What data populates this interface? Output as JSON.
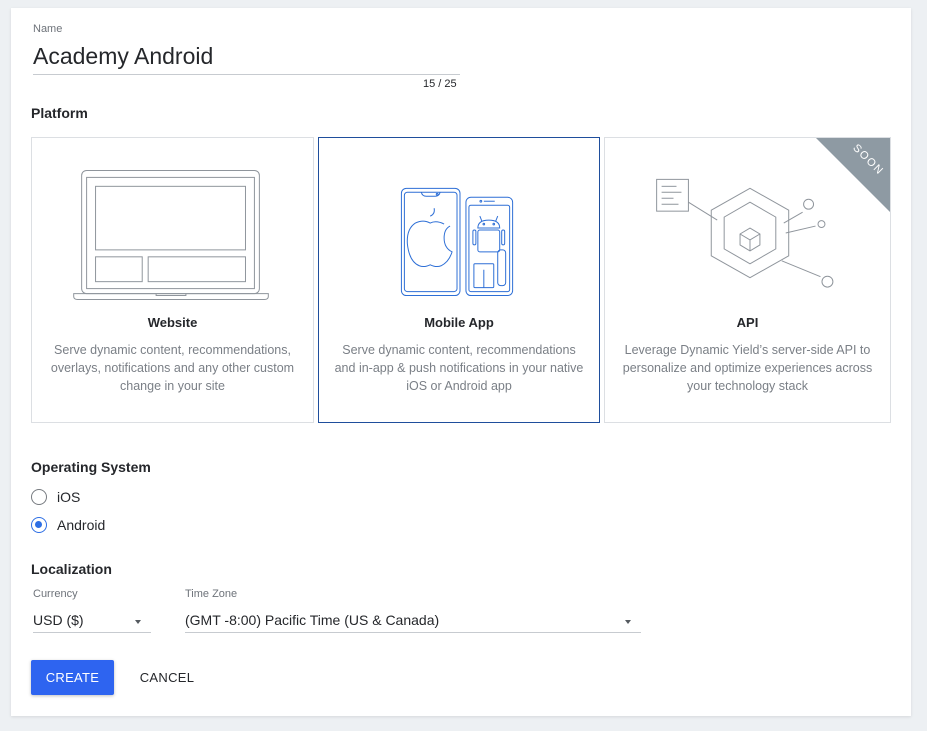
{
  "name_field": {
    "label": "Name",
    "value": "Academy Android",
    "char_count": "15 / 25"
  },
  "platform": {
    "title": "Platform",
    "cards": [
      {
        "title": "Website",
        "description": "Serve dynamic content, recommendations, overlays, notifications and any other custom change in your site",
        "illustration": "laptop-icon",
        "selected": false
      },
      {
        "title": "Mobile App",
        "description": "Serve dynamic content, recommendations and in-app & push notifications in your native iOS or Android app",
        "illustration": "mobile-phones-icon",
        "selected": true
      },
      {
        "title": "API",
        "description": "Leverage Dynamic Yield’s server-side API to personalize and optimize experiences across your technology stack",
        "illustration": "api-hexagon-icon",
        "selected": false,
        "badge": "SOON"
      }
    ]
  },
  "operating_system": {
    "title": "Operating System",
    "options": [
      {
        "label": "iOS",
        "checked": false
      },
      {
        "label": "Android",
        "checked": true
      }
    ]
  },
  "localization": {
    "title": "Localization",
    "currency": {
      "label": "Currency",
      "value": "USD ($)"
    },
    "timezone": {
      "label": "Time Zone",
      "value": "(GMT -8:00) Pacific Time (US & Canada)"
    }
  },
  "actions": {
    "create_label": "CREATE",
    "cancel_label": "CANCEL"
  },
  "colors": {
    "primary": "#2e64f0",
    "selected_border": "#1f4e9c",
    "mobile_illustration": "#2e6fd6",
    "badge": "#8e9aa3"
  }
}
